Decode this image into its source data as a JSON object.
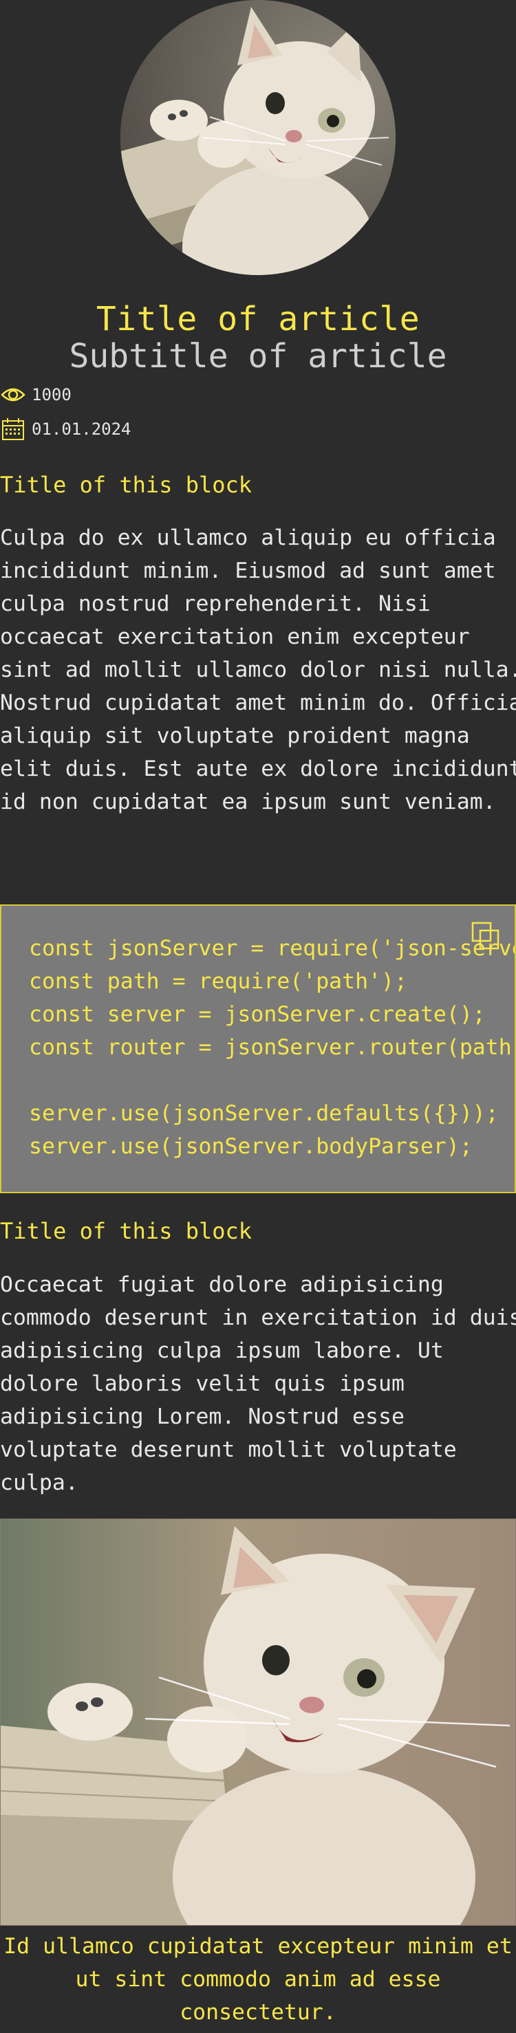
{
  "article": {
    "title": "Title of article",
    "subtitle": "Subtitle of article",
    "views": "1000",
    "date": "01.01.2024"
  },
  "icons": {
    "views": "eye-icon",
    "date": "calendar-icon",
    "copy": "copy-icon"
  },
  "blocks": [
    {
      "title": "Title of this block",
      "text": "Culpa do ex ullamco aliquip eu officia incididunt minim. Eiusmod ad sunt amet culpa nostrud reprehenderit. Nisi occaecat exercitation enim excepteur sint ad mollit ullamco dolor nisi nulla. Nostrud cupidatat amet minim do. Officia aliquip sit voluptate proident magna elit duis. Est aute ex dolore incididunt id non cupidatat ea ipsum sunt veniam."
    },
    {
      "title": "Title of this block",
      "text": "Occaecat fugiat dolore adipisicing commodo deserunt in exercitation id duis adipisicing culpa ipsum labore. Ut dolore laboris velit quis ipsum adipisicing Lorem. Nostrud esse voluptate deserunt mollit voluptate culpa."
    }
  ],
  "code": "const jsonServer = require('json-server');\nconst path = require('path');\nconst server = jsonServer.create();\nconst router = jsonServer.router(path.resolve(__dirname, 'db.json'));\n\nserver.use(jsonServer.defaults({}));\nserver.use(jsonServer.bodyParser);",
  "image_caption": "Id ullamco cupidatat excepteur minim et ut sint commodo anim ad esse consectetur.",
  "colors": {
    "background": "#2c2c2c",
    "accent": "#f7e64a",
    "text": "#e6e6e6",
    "code_bg": "#7a7a7a"
  }
}
